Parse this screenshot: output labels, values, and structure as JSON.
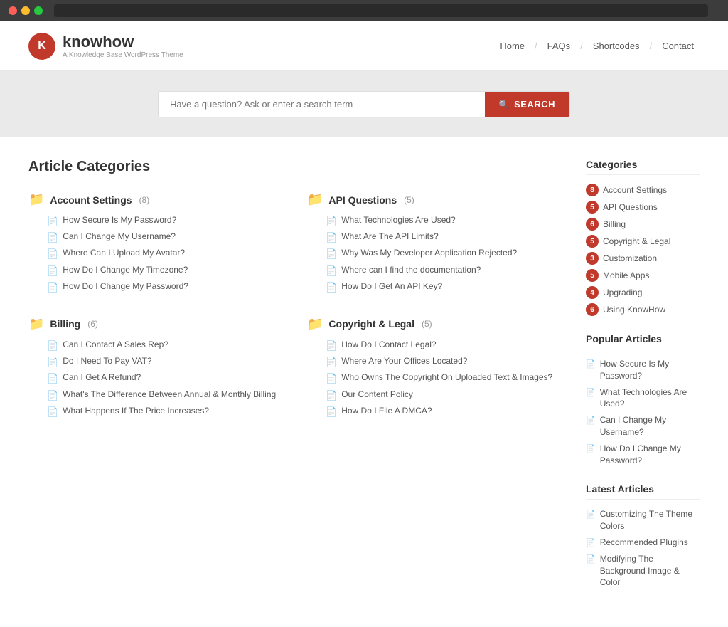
{
  "window": {
    "title": "knowhow"
  },
  "nav": {
    "logo_text": "knowhow",
    "logo_subtitle": "A Knowledge Base WordPress Theme",
    "links": [
      "Home",
      "FAQs",
      "Shortcodes",
      "Contact"
    ]
  },
  "search": {
    "placeholder": "Have a question? Ask or enter a search term",
    "button_label": "SEARCH"
  },
  "articles": {
    "title": "Article Categories",
    "categories": [
      {
        "name": "Account Settings",
        "count": "(8)",
        "articles": [
          "How Secure Is My Password?",
          "Can I Change My Username?",
          "Where Can I Upload My Avatar?",
          "How Do I Change My Timezone?",
          "How Do I Change My Password?"
        ]
      },
      {
        "name": "API Questions",
        "count": "(5)",
        "articles": [
          "What Technologies Are Used?",
          "What Are The API Limits?",
          "Why Was My Developer Application Rejected?",
          "Where can I find the documentation?",
          "How Do I Get An API Key?"
        ]
      },
      {
        "name": "Billing",
        "count": "(6)",
        "articles": [
          "Can I Contact A Sales Rep?",
          "Do I Need To Pay VAT?",
          "Can I Get A Refund?",
          "What's The Difference Between Annual & Monthly Billing",
          "What Happens If The Price Increases?"
        ]
      },
      {
        "name": "Copyright & Legal",
        "count": "(5)",
        "articles": [
          "How Do I Contact Legal?",
          "Where Are Your Offices Located?",
          "Who Owns The Copyright On Uploaded Text & Images?",
          "Our Content Policy",
          "How Do I File A DMCA?"
        ]
      }
    ]
  },
  "sidebar": {
    "categories_title": "Categories",
    "categories": [
      {
        "name": "Account Settings",
        "count": "8"
      },
      {
        "name": "API Questions",
        "count": "5"
      },
      {
        "name": "Billing",
        "count": "6"
      },
      {
        "name": "Copyright & Legal",
        "count": "5"
      },
      {
        "name": "Customization",
        "count": "3"
      },
      {
        "name": "Mobile Apps",
        "count": "5"
      },
      {
        "name": "Upgrading",
        "count": "4"
      },
      {
        "name": "Using KnowHow",
        "count": "6"
      }
    ],
    "popular_title": "Popular Articles",
    "popular": [
      "How Secure Is My Password?",
      "What Technologies Are Used?",
      "Can I Change My Username?",
      "How Do I Change My Password?"
    ],
    "latest_title": "Latest Articles",
    "latest": [
      "Customizing The Theme Colors",
      "Recommended Plugins",
      "Modifying The Background Image & Color"
    ]
  }
}
